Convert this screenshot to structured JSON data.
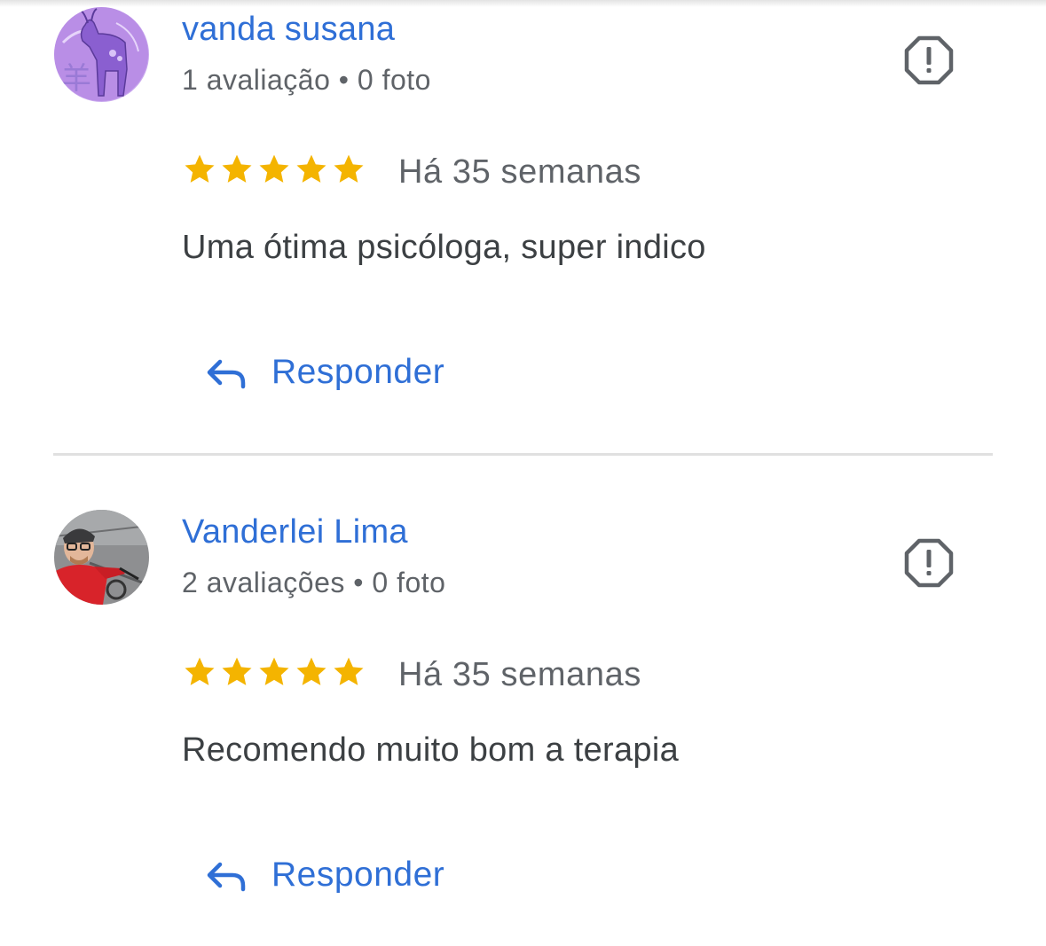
{
  "reviews": [
    {
      "author": "vanda susana",
      "meta": "1 avaliação • 0 foto",
      "rating": 5,
      "date": "Há 35 semanas",
      "text": "Uma ótima psicóloga, super indico",
      "reply_label": "Responder"
    },
    {
      "author": "Vanderlei Lima",
      "meta": "2 avaliações • 0 foto",
      "rating": 5,
      "date": "Há 35 semanas",
      "text": "Recomendo muito bom a terapia",
      "reply_label": "Responder"
    }
  ],
  "icons": {
    "report": "report-flag-icon",
    "star": "star-icon",
    "reply": "reply-arrow-icon"
  },
  "colors": {
    "link": "#2f6fd6",
    "star": "#f4b400",
    "secondary_text": "#5f6368",
    "divider": "#e0e0e0"
  }
}
